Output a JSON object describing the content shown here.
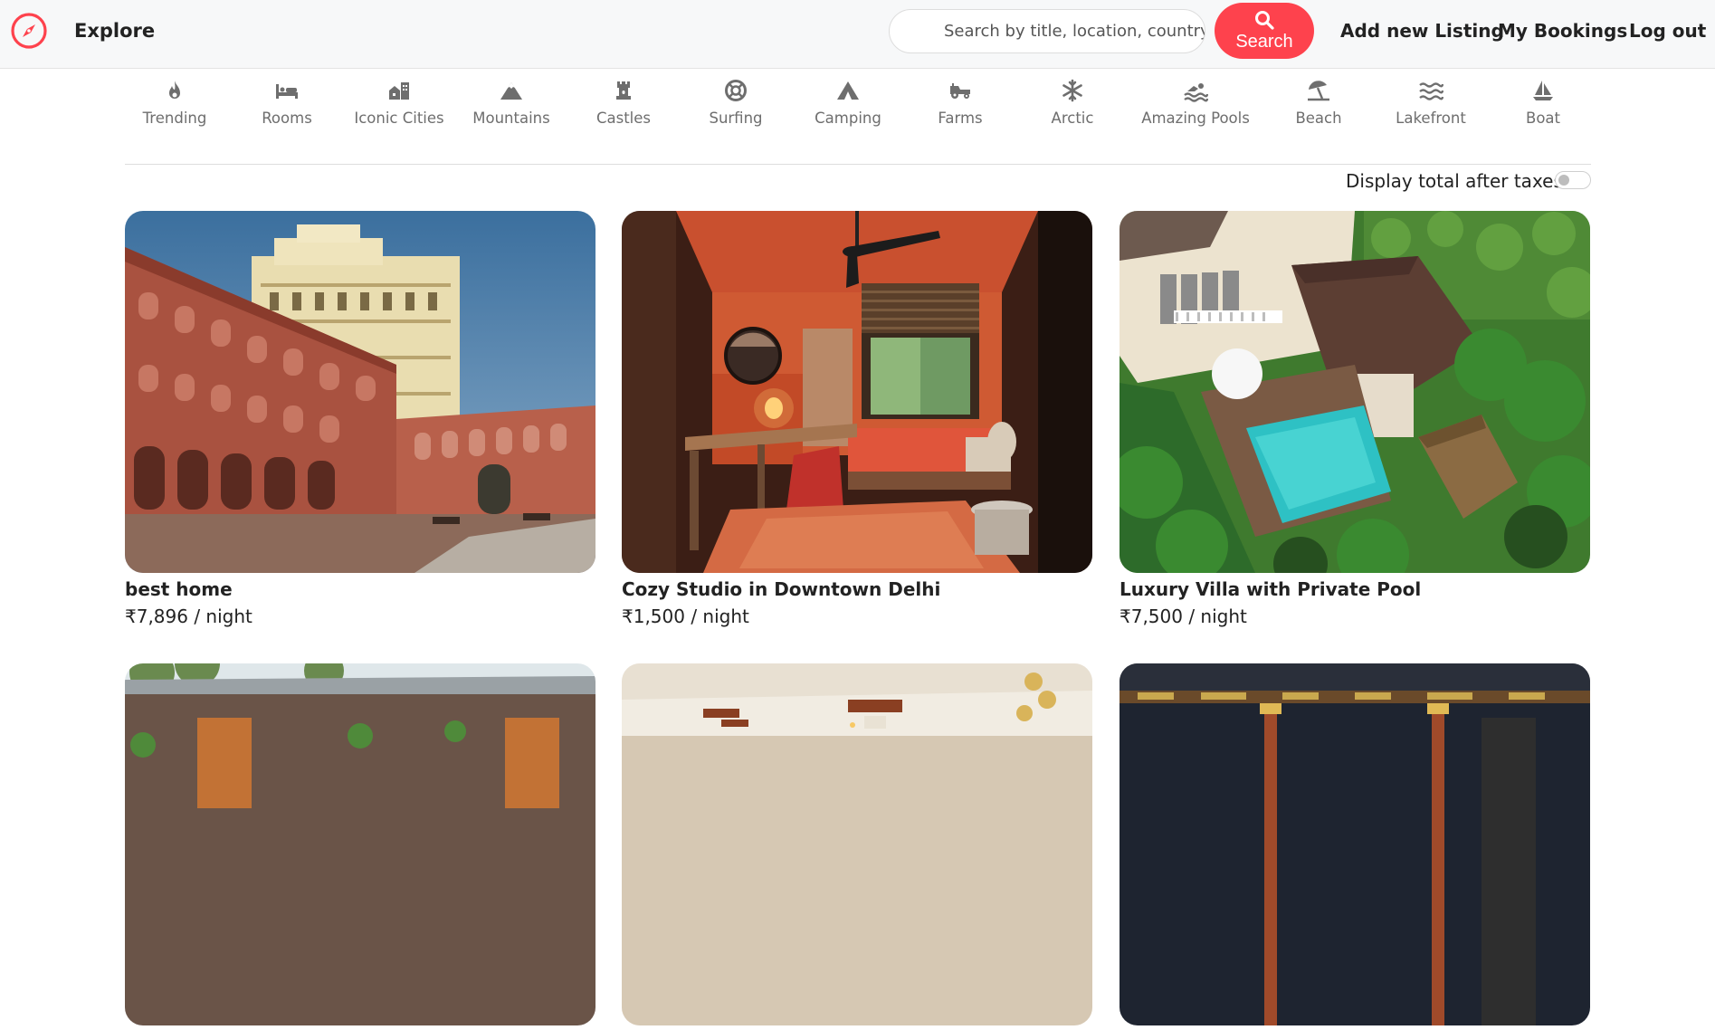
{
  "navbar": {
    "explore_label": "Explore",
    "search_placeholder": "Search by title, location, country",
    "search_button_label": "Search",
    "add_listing_label": "Add new Listing",
    "bookings_label": "My Bookings",
    "logout_label": "Log out",
    "brand_icon": "compass-icon",
    "accent_color": "#fe424d"
  },
  "filters": [
    {
      "label": "Trending",
      "icon": "fire-icon"
    },
    {
      "label": "Rooms",
      "icon": "bed-icon"
    },
    {
      "label": "Iconic Cities",
      "icon": "city-icon"
    },
    {
      "label": "Mountains",
      "icon": "mountain-icon"
    },
    {
      "label": "Castles",
      "icon": "castle-icon"
    },
    {
      "label": "Surfing",
      "icon": "lifebuoy-icon"
    },
    {
      "label": "Camping",
      "icon": "tent-icon"
    },
    {
      "label": "Farms",
      "icon": "tractor-icon"
    },
    {
      "label": "Arctic",
      "icon": "snowflake-icon"
    },
    {
      "label": "Amazing Pools",
      "icon": "swimmer-icon"
    },
    {
      "label": "Beach",
      "icon": "umbrella-beach-icon"
    },
    {
      "label": "Lakefront",
      "icon": "water-icon"
    },
    {
      "label": "Boat",
      "icon": "sailboat-icon"
    }
  ],
  "tax_toggle": {
    "label": "Display total after taxes",
    "enabled": false
  },
  "listings": [
    {
      "title": "best home",
      "price": "₹7,896 / night"
    },
    {
      "title": "Cozy Studio in Downtown Delhi",
      "price": "₹1,500 / night"
    },
    {
      "title": "Luxury Villa with Private Pool",
      "price": "₹7,500 / night"
    },
    {
      "title": "",
      "price": ""
    },
    {
      "title": "",
      "price": ""
    },
    {
      "title": "",
      "price": ""
    }
  ]
}
